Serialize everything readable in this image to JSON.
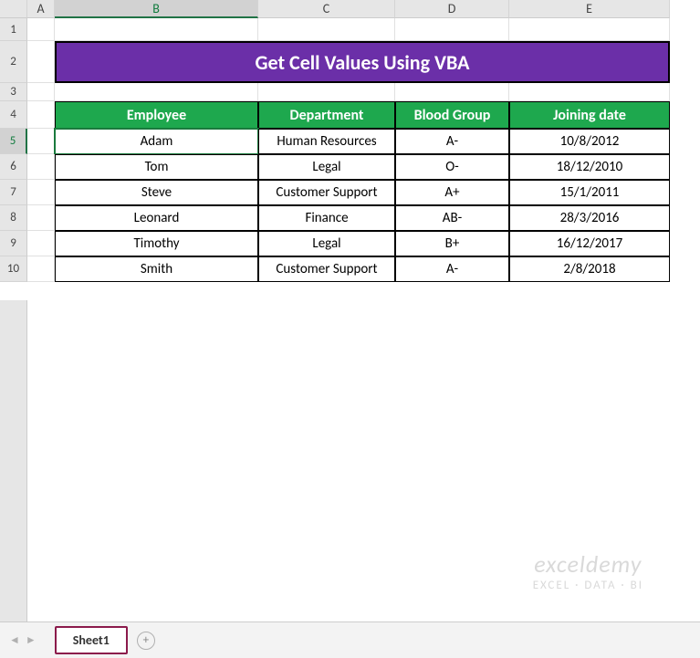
{
  "columns": {
    "corner": "",
    "A": "A",
    "B": "B",
    "C": "C",
    "D": "D",
    "E": "E"
  },
  "rows": {
    "r1": "1",
    "r2": "2",
    "r3": "3",
    "r4": "4",
    "r5": "5",
    "r6": "6",
    "r7": "7",
    "r8": "8",
    "r9": "9",
    "r10": "10"
  },
  "title": "Get Cell Values Using VBA",
  "headers": {
    "employee": "Employee",
    "department": "Department",
    "blood": "Blood Group",
    "joining": "Joining date"
  },
  "data": [
    {
      "employee": "Adam",
      "department": "Human Resources",
      "blood": "A-",
      "joining": "10/8/2012"
    },
    {
      "employee": "Tom",
      "department": "Legal",
      "blood": "O-",
      "joining": "18/12/2010"
    },
    {
      "employee": "Steve",
      "department": "Customer Support",
      "blood": "A+",
      "joining": "15/1/2011"
    },
    {
      "employee": "Leonard",
      "department": "Finance",
      "blood": "AB-",
      "joining": "28/3/2016"
    },
    {
      "employee": "Timothy",
      "department": "Legal",
      "blood": "B+",
      "joining": "16/12/2017"
    },
    {
      "employee": "Smith",
      "department": "Customer Support",
      "blood": "A-",
      "joining": "2/8/2018"
    }
  ],
  "watermark": {
    "brand": "exceldemy",
    "tagline": "EXCEL · DATA · BI"
  },
  "tabs": {
    "sheet1": "Sheet1"
  },
  "active_cell": "B5"
}
